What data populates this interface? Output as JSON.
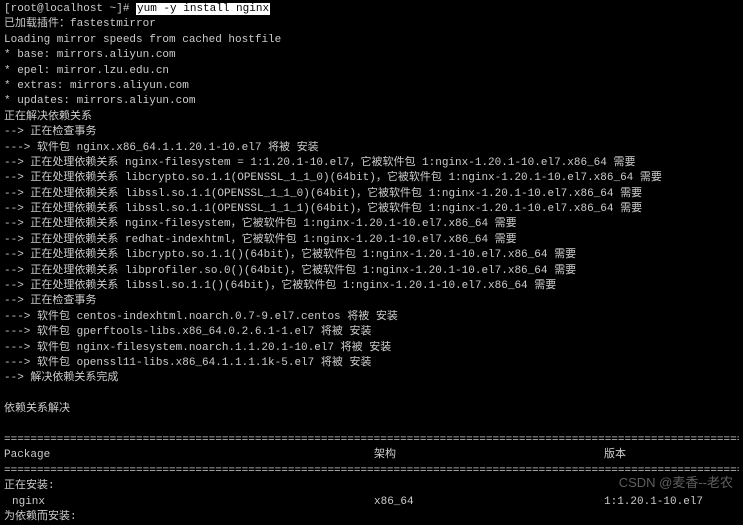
{
  "prompt": "[root@localhost ~]# ",
  "command": "yum -y install nginx",
  "lines": [
    "已加载插件：fastestmirror",
    "Loading mirror speeds from cached hostfile",
    " * base: mirrors.aliyun.com",
    " * epel: mirror.lzu.edu.cn",
    " * extras: mirrors.aliyun.com",
    " * updates: mirrors.aliyun.com",
    "正在解决依赖关系",
    "--> 正在检查事务",
    "---> 软件包 nginx.x86_64.1.1.20.1-10.el7 将被 安装",
    "--> 正在处理依赖关系 nginx-filesystem = 1:1.20.1-10.el7，它被软件包 1:nginx-1.20.1-10.el7.x86_64 需要",
    "--> 正在处理依赖关系 libcrypto.so.1.1(OPENSSL_1_1_0)(64bit)，它被软件包 1:nginx-1.20.1-10.el7.x86_64 需要",
    "--> 正在处理依赖关系 libssl.so.1.1(OPENSSL_1_1_0)(64bit)，它被软件包 1:nginx-1.20.1-10.el7.x86_64 需要",
    "--> 正在处理依赖关系 libssl.so.1.1(OPENSSL_1_1_1)(64bit)，它被软件包 1:nginx-1.20.1-10.el7.x86_64 需要",
    "--> 正在处理依赖关系 nginx-filesystem，它被软件包 1:nginx-1.20.1-10.el7.x86_64 需要",
    "--> 正在处理依赖关系 redhat-indexhtml，它被软件包 1:nginx-1.20.1-10.el7.x86_64 需要",
    "--> 正在处理依赖关系 libcrypto.so.1.1()(64bit)，它被软件包 1:nginx-1.20.1-10.el7.x86_64 需要",
    "--> 正在处理依赖关系 libprofiler.so.0()(64bit)，它被软件包 1:nginx-1.20.1-10.el7.x86_64 需要",
    "--> 正在处理依赖关系 libssl.so.1.1()(64bit)，它被软件包 1:nginx-1.20.1-10.el7.x86_64 需要",
    "--> 正在检查事务",
    "---> 软件包 centos-indexhtml.noarch.0.7-9.el7.centos 将被 安装",
    "---> 软件包 gperftools-libs.x86_64.0.2.6.1-1.el7 将被 安装",
    "---> 软件包 nginx-filesystem.noarch.1.1.20.1-10.el7 将被 安装",
    "---> 软件包 openssl11-libs.x86_64.1.1.1.1k-5.el7 将被 安装",
    "--> 解决依赖关系完成"
  ],
  "deps_resolved": "依赖关系解决",
  "divider": "================================================================================================================================",
  "table_header": {
    "package": " Package",
    "arch": "架构",
    "version": "版本"
  },
  "installing_label": "正在安装:",
  "pkg_row": {
    "name": "nginx",
    "arch": "x86_64",
    "version": "1:1.20.1-10.el7"
  },
  "deps_install_label": "为依赖而安装:",
  "watermark": "CSDN @麦香--老农"
}
